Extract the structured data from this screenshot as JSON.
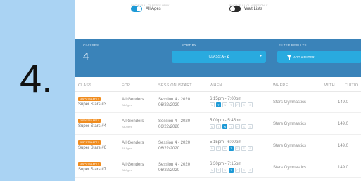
{
  "step": {
    "number": "4."
  },
  "toggles": [
    {
      "caption": "SHOW FULL CLASSES ONLY",
      "label": "All Ages",
      "on": true
    },
    {
      "caption": "SHOW FULL CLASSES ONLY",
      "label": "Wait Lists",
      "on": false
    }
  ],
  "filterbar": {
    "classes_label": "CLASSES",
    "classes_count": "4",
    "sort_label": "SORT BY",
    "sort_prefix": "CLASS: ",
    "sort_value": "A - Z",
    "filter_label": "FILTER RESULTS",
    "add_filter_label": "ADD A FILTER",
    "accent_color": "#3a83b9"
  },
  "table": {
    "headers": {
      "class": "CLASS",
      "for": "FOR",
      "session": "SESSION /START",
      "when": "WHEN",
      "where": "WHERE",
      "with": "WITH",
      "tuition": "TUITIO"
    },
    "rows": [
      {
        "badge": "3 SPOTS LEFT !",
        "name": "Super Stars #3",
        "for": "All Genders",
        "ages": "All Ages",
        "session": "Session 4 - 2020",
        "start": "06/22/2020",
        "time": "6:15pm - 7:00pm",
        "days": [
          "M",
          "T",
          "W",
          "T",
          "F",
          "S",
          "S"
        ],
        "active_day": 1,
        "where": "Stars Gymnastics",
        "tuition": "149.0"
      },
      {
        "badge": "3 SPOTS LEFT !",
        "name": "Super Stars #4",
        "for": "All Genders",
        "ages": "All Ages",
        "session": "Session 4 - 2020",
        "start": "06/22/2020",
        "time": "5:00pm - 5:45pm",
        "days": [
          "M",
          "T",
          "W",
          "T",
          "F",
          "S",
          "S"
        ],
        "active_day": 2,
        "where": "Stars Gymnastics",
        "tuition": "149.0"
      },
      {
        "badge": "3 SPOTS LEFT !",
        "name": "Super Stars #6",
        "for": "All Genders",
        "ages": "All Ages",
        "session": "Session 4 - 2020",
        "start": "06/22/2020",
        "time": "5:15pm - 6:00pm",
        "days": [
          "M",
          "T",
          "W",
          "T",
          "F",
          "S",
          "S"
        ],
        "active_day": 3,
        "where": "Stars Gymnastics",
        "tuition": "149.0"
      },
      {
        "badge": "3 SPOTS LEFT !",
        "name": "Super Stars #7",
        "for": "All Genders",
        "ages": "All Ages",
        "session": "Session 4 - 2020",
        "start": "06/22/2020",
        "time": "6:30pm - 7:15pm",
        "days": [
          "M",
          "T",
          "W",
          "T",
          "F",
          "S",
          "S"
        ],
        "active_day": 3,
        "where": "Stars Gymnastics",
        "tuition": "149.0"
      }
    ]
  }
}
